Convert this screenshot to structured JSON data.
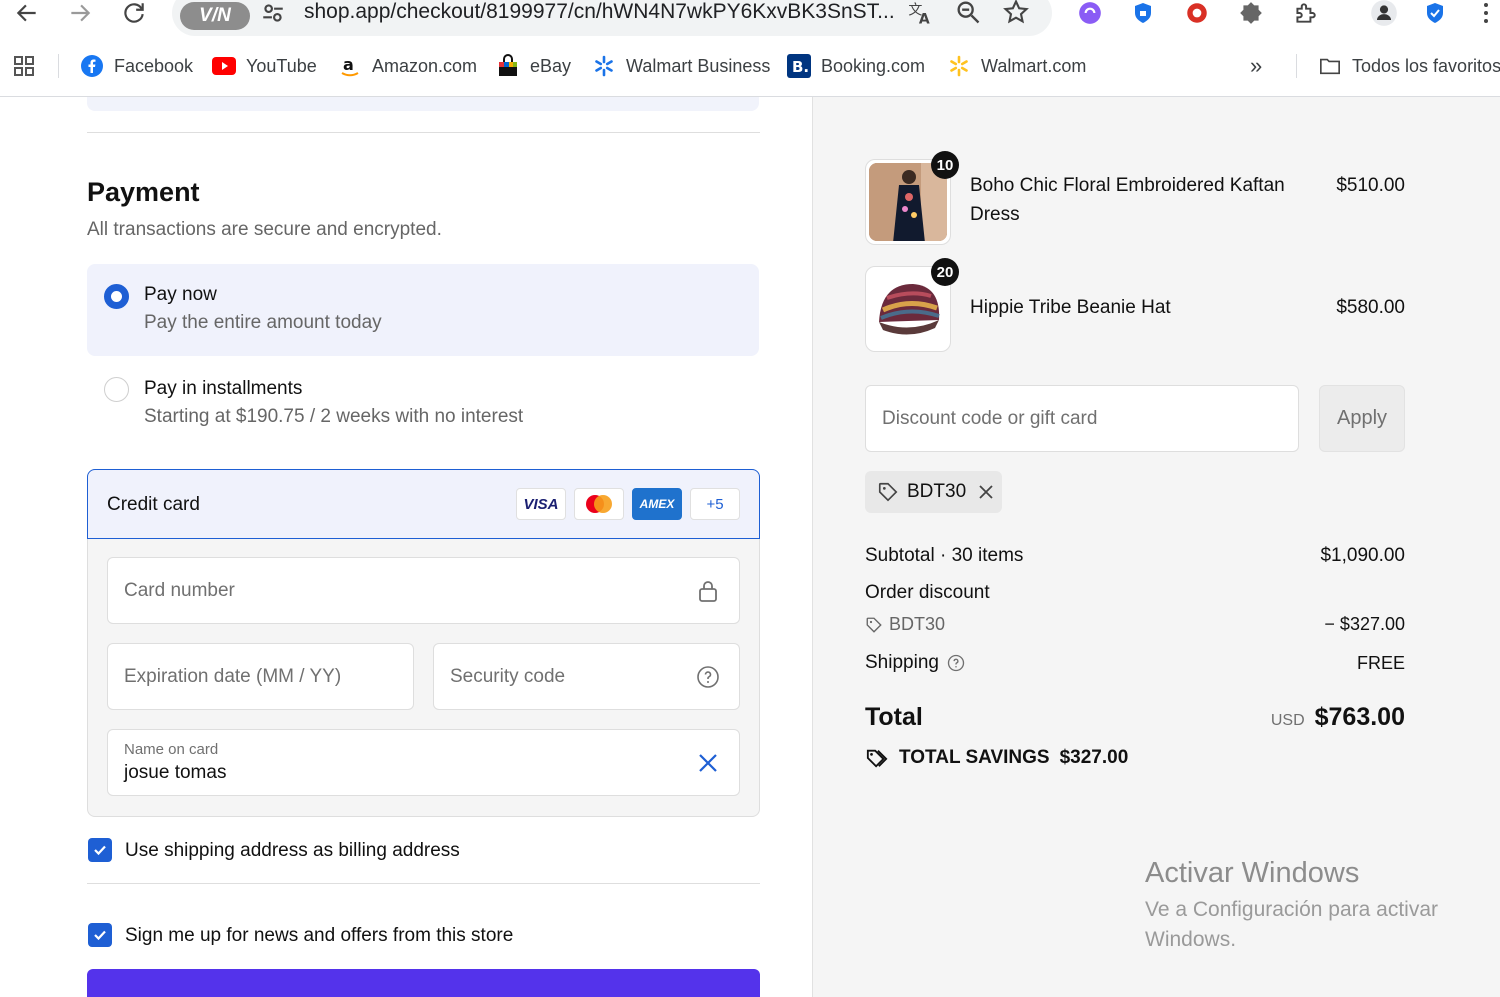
{
  "browser": {
    "vpn_label": "V/N",
    "url": "shop.app/checkout/8199977/cn/hWN4N7wkPY6KxvBK3SnST...",
    "bookmarks": [
      {
        "label": "Facebook"
      },
      {
        "label": "YouTube"
      },
      {
        "label": "Amazon.com"
      },
      {
        "label": "eBay"
      },
      {
        "label": "Walmart Business"
      },
      {
        "label": "Booking.com"
      },
      {
        "label": "Walmart.com"
      }
    ],
    "more_bookmarks": "»",
    "all_bookmarks": "Todos los favoritos"
  },
  "payment": {
    "title": "Payment",
    "subtitle": "All transactions are secure and encrypted.",
    "options": [
      {
        "title": "Pay now",
        "description": "Pay the entire amount today",
        "selected": true
      },
      {
        "title": "Pay in installments",
        "description": "Starting at $190.75 / 2 weeks with no interest",
        "selected": false
      }
    ],
    "credit_card": {
      "label": "Credit card",
      "brands": [
        "VISA",
        "Mastercard",
        "AMEX"
      ],
      "more_brands": "+5",
      "card_number_placeholder": "Card number",
      "expiration_placeholder": "Expiration date (MM / YY)",
      "security_code_placeholder": "Security code",
      "name_label": "Name on card",
      "name_value": "josue tomas"
    },
    "billing_checkbox_label": "Use shipping address as billing address",
    "newsletter_checkbox_label": "Sign me up for news and offers from this store"
  },
  "order": {
    "items": [
      {
        "name": "Boho Chic Floral Embroidered Kaftan Dress",
        "price": "$510.00",
        "quantity": "10"
      },
      {
        "name": "Hippie Tribe Beanie Hat",
        "price": "$580.00",
        "quantity": "20"
      }
    ],
    "discount_placeholder": "Discount code or gift card",
    "apply_label": "Apply",
    "applied_code": "BDT30",
    "subtotal_label": "Subtotal · 30 items",
    "subtotal_value": "$1,090.00",
    "order_discount_label": "Order discount",
    "discount_code": "BDT30",
    "discount_value": "− $327.00",
    "shipping_label": "Shipping",
    "shipping_value": "FREE",
    "total_label": "Total",
    "currency": "USD",
    "total_value": "$763.00",
    "savings_label": "TOTAL SAVINGS",
    "savings_value": "$327.00"
  },
  "watermark": {
    "title": "Activar Windows",
    "subtitle": "Ve a Configuración para activar Windows."
  },
  "colors": {
    "accent": "#1e5fd4",
    "pay_button": "#5433eb",
    "selected_bg": "#f0f2fc"
  }
}
